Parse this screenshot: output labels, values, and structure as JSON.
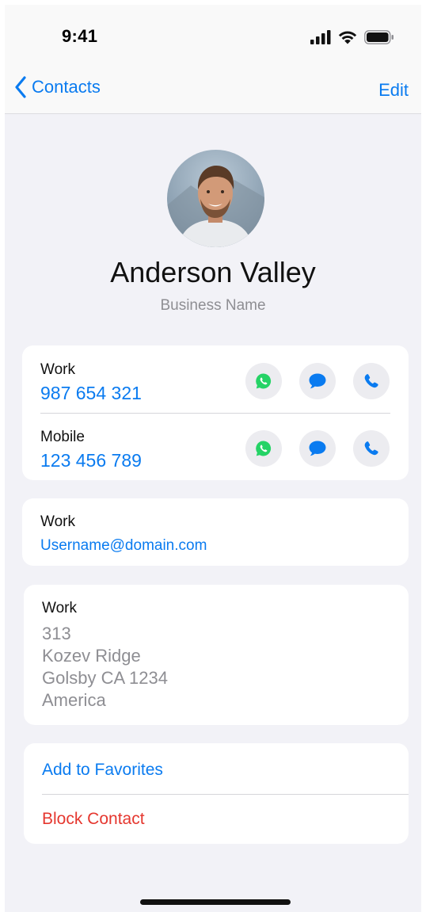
{
  "status_bar": {
    "time": "9:41"
  },
  "nav": {
    "back_label": "Contacts",
    "edit_label": "Edit"
  },
  "contact": {
    "name": "Anderson Valley",
    "business": "Business Name"
  },
  "phones": [
    {
      "label": "Work",
      "number": "987 654 321"
    },
    {
      "label": "Mobile",
      "number": "123 456 789"
    }
  ],
  "email": {
    "label": "Work",
    "value": "Username@domain.com"
  },
  "address": {
    "label": "Work",
    "lines": [
      "313",
      "Kozev Ridge",
      "Golsby CA 1234",
      "America"
    ]
  },
  "actions": {
    "favorites_label": "Add to Favorites",
    "block_label": "Block Contact"
  },
  "colors": {
    "accent": "#0a7bf0",
    "destructive": "#e5372f",
    "whatsapp": "#25d366"
  }
}
